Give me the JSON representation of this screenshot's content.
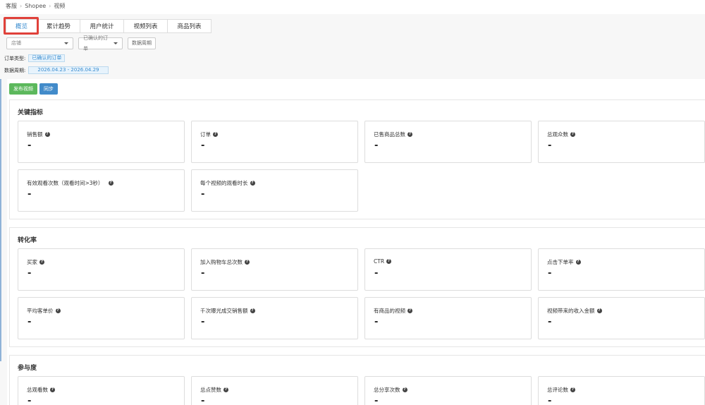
{
  "breadcrumb": [
    "客服",
    "Shopee",
    "视频"
  ],
  "tabs": [
    "概览",
    "累计趋势",
    "用户统计",
    "视频列表",
    "商品列表"
  ],
  "filters": {
    "shop_placeholder": "店铺",
    "order_status": "已确认的订单",
    "date_range_button": "数据周期"
  },
  "filter_info": {
    "order_type_label": "订单类型:",
    "order_type_value": "已确认的订单",
    "period_label": "数据周期:",
    "period_value": "2026.04.23 - 2026.04.29"
  },
  "actions": {
    "publish": "发布视频",
    "sync": "同步"
  },
  "sections": [
    {
      "title": "关键指标",
      "cards": [
        {
          "label": "销售额",
          "value": "-"
        },
        {
          "label": "订单",
          "value": "-"
        },
        {
          "label": "已售商品总数",
          "value": "-"
        },
        {
          "label": "总观众数",
          "value": "-"
        },
        {
          "label": "有效观看次数（观看时间>3秒）",
          "value": "-"
        },
        {
          "label": "每个视频的观看时长",
          "value": "-"
        }
      ]
    },
    {
      "title": "转化率",
      "cards": [
        {
          "label": "买家",
          "value": "-"
        },
        {
          "label": "加入购物车总次数",
          "value": "-"
        },
        {
          "label": "CTR",
          "value": "-"
        },
        {
          "label": "点击下单率",
          "value": "-"
        },
        {
          "label": "平均客单价",
          "value": "-"
        },
        {
          "label": "千次曝光成交销售额",
          "value": "-"
        },
        {
          "label": "有商品的视频",
          "value": "-"
        },
        {
          "label": "视频带来的收入金额",
          "value": "-"
        }
      ]
    },
    {
      "title": "参与度",
      "cards": [
        {
          "label": "总观看数",
          "value": "-"
        },
        {
          "label": "总点赞数",
          "value": "-"
        },
        {
          "label": "总分享次数",
          "value": "-"
        },
        {
          "label": "总评论数",
          "value": "-"
        }
      ]
    }
  ],
  "colors": {
    "accent": "#3a8ccf",
    "highlight": "#e0413a",
    "green": "#5cb85c",
    "blue": "#428bca"
  }
}
